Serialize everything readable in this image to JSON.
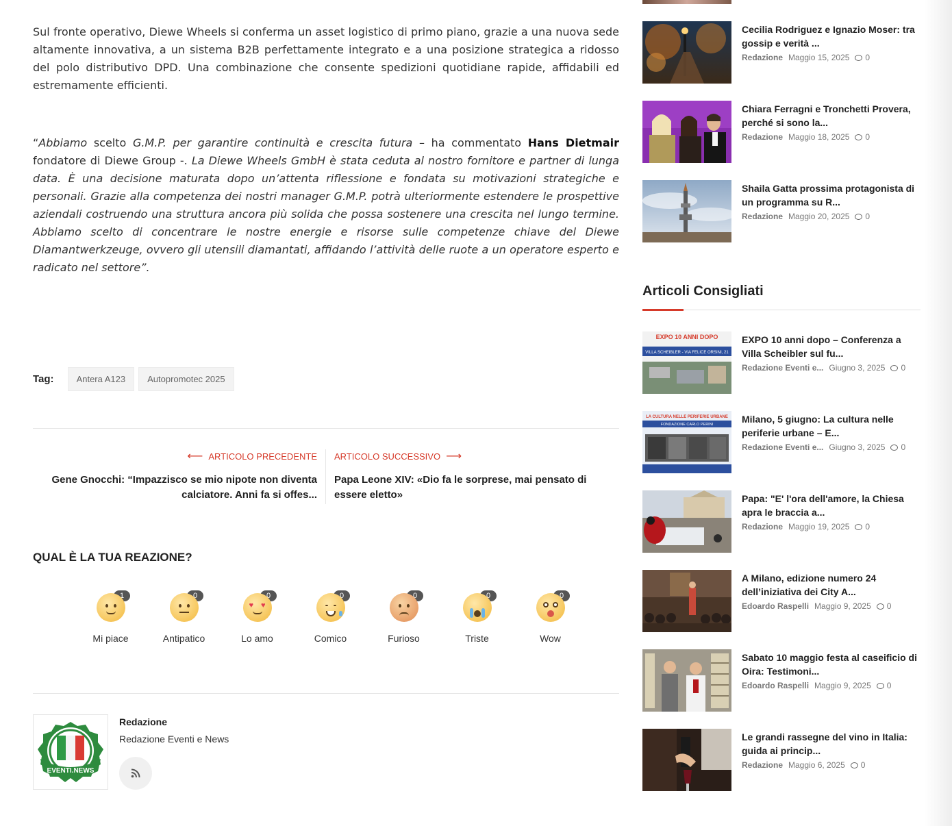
{
  "article": {
    "para1": "Sul fronte operativo, Diewe Wheels si conferma un asset logistico di primo piano, grazie a una nuova sede altamente innovativa, a un sistema B2B perfettamente integrato e a una posizione strategica a ridosso del polo distributivo DPD. Una combinazione che consente spedizioni quotidiane rapide, affidabili ed estremamente efficienti.",
    "quote_open": "“",
    "quote_italic_1": "Abbiamo",
    "quote_text_1": " scelto ",
    "quote_italic_2": "G.M.P. per garantire continuità e crescita futura",
    "quote_text_2": " – ha commentato ",
    "quote_bold": "Hans Dietmair",
    "quote_text_3": " fondatore di Diewe Group -. ",
    "quote_italic_3": "La Diewe Wheels GmbH è stata ceduta al nostro fornitore e partner di lunga data. È una decisione maturata dopo un’attenta riflessione e fondata su motivazioni strategiche e personali. Grazie alla competenza dei nostri manager G.M.P. potrà ulteriormente estendere le prospettive aziendali costruendo una struttura ancora più solida che possa sostenere una crescita nel lungo termine. Abbiamo scelto di concentrare le nostre energie e risorse sulle competenze chiave del Diewe Diamantwerkzeuge, ovvero gli utensili diamantati, affidando l’attività delle ruote a un operatore esperto e radicato nel settore”."
  },
  "tags": {
    "label": "Tag:",
    "items": [
      "Antera A123",
      "Autopromotec 2025"
    ]
  },
  "post_nav": {
    "prev_label": "ARTICOLO PRECEDENTE",
    "prev_title": "Gene Gnocchi: “Impazzisco se mio nipote non diventa calciatore. Anni fa si offes...",
    "next_label": "ARTICOLO SUCCESSIVO",
    "next_title": "Papa Leone XIV: «Dio fa le sorprese, mai pensato di essere eletto»"
  },
  "reactions": {
    "title": "QUAL È LA TUA REAZIONE?",
    "items": [
      {
        "label": "Mi piace",
        "count": "1"
      },
      {
        "label": "Antipatico",
        "count": "0"
      },
      {
        "label": "Lo amo",
        "count": "0"
      },
      {
        "label": "Comico",
        "count": "0"
      },
      {
        "label": "Furioso",
        "count": "0"
      },
      {
        "label": "Triste",
        "count": "0"
      },
      {
        "label": "Wow",
        "count": "0"
      }
    ]
  },
  "author": {
    "name": "Redazione",
    "description": "Redazione Eventi e News",
    "logo_text": "EVENTI.NEWS"
  },
  "sidebar": {
    "top_items": [
      {
        "title": "Cecilia Rodriguez e Ignazio Moser: tra gossip e verità ...",
        "author": "Redazione",
        "date": "Maggio 15, 2025",
        "comments": "0"
      },
      {
        "title": "Chiara Ferragni e Tronchetti Provera, perché si sono la...",
        "author": "Redazione",
        "date": "Maggio 18, 2025",
        "comments": "0"
      },
      {
        "title": "Shaila Gatta prossima protagonista di un programma su R...",
        "author": "Redazione",
        "date": "Maggio 20, 2025",
        "comments": "0"
      }
    ],
    "section_title": "Articoli Consigliati",
    "recommended": [
      {
        "title": "EXPO 10 anni dopo – Conferenza a Villa Scheibler sul fu...",
        "author": "Redazione Eventi e...",
        "date": "Giugno 3, 2025",
        "comments": "0"
      },
      {
        "title": "Milano, 5 giugno: La cultura nelle periferie urbane – E...",
        "author": "Redazione Eventi e...",
        "date": "Giugno 3, 2025",
        "comments": "0"
      },
      {
        "title": "Papa: \"E' l'ora dell'amore, la Chiesa apra le braccia a...",
        "author": "Redazione",
        "date": "Maggio 19, 2025",
        "comments": "0"
      },
      {
        "title": "A Milano, edizione numero 24 dell’iniziativa dei City A...",
        "author": "Edoardo Raspelli",
        "date": "Maggio 9, 2025",
        "comments": "0"
      },
      {
        "title": "Sabato 10 maggio festa al caseificio di Oira: Testimoni...",
        "author": "Edoardo Raspelli",
        "date": "Maggio 9, 2025",
        "comments": "0"
      },
      {
        "title": "Le grandi rassegne del vino in Italia: guida ai princip...",
        "author": "Redazione",
        "date": "Maggio 6, 2025",
        "comments": "0"
      }
    ],
    "thumb_texts": {
      "expo_1": "EXPO 10 ANNI DOPO",
      "expo_2": "VILLA SCHEIBLER - VIA FELICE ORSINI, 21",
      "periferie_1": "LA CULTURA NELLE PERIFERIE URBANE",
      "periferie_2": "FONDAZIONE CARLO PERINI"
    }
  },
  "colors": {
    "accent": "#d63a2a",
    "text": "#222222",
    "meta": "#777777"
  }
}
